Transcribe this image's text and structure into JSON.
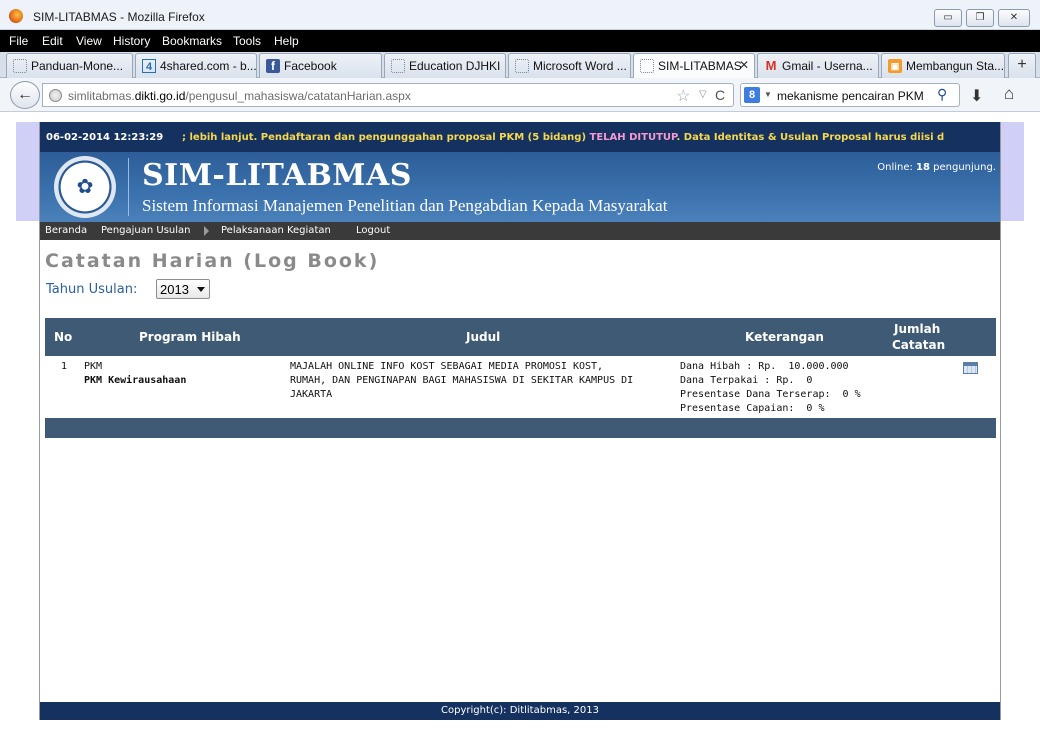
{
  "window": {
    "title": "SIM-LITABMAS - Mozilla Firefox",
    "min_icon": "minimize-icon",
    "max_icon": "maximize-icon",
    "close_icon": "close-icon"
  },
  "menu": [
    "File",
    "Edit",
    "View",
    "History",
    "Bookmarks",
    "Tools",
    "Help"
  ],
  "tabs": [
    {
      "label": "Panduan-Mone...",
      "icon": "blank-page-icon"
    },
    {
      "label": "4shared.com - b...",
      "icon": "4shared-icon"
    },
    {
      "label": "Facebook",
      "icon": "facebook-icon"
    },
    {
      "label": "Education DJHKI",
      "icon": "blank-page-icon"
    },
    {
      "label": "Microsoft Word ...",
      "icon": "blank-page-icon"
    },
    {
      "label": "SIM-LITABMAS",
      "icon": "blank-page-icon",
      "active": true
    },
    {
      "label": "Gmail - Userna...",
      "icon": "gmail-icon"
    },
    {
      "label": "Membangun Sta...",
      "icon": "orange-site-icon"
    }
  ],
  "address": {
    "url_prefix": "simlitabmas.",
    "url_domain": "dikti.go.id",
    "url_path": "/pengusul_mahasiswa/catatanHarian.aspx"
  },
  "search": {
    "engine_icon": "google-icon",
    "value": "mekanisme pencairan PKM"
  },
  "site": {
    "date": "06-02-2014",
    "time": "12:23:29",
    "marquee_a": "; lebih lanjut.   Pendaftaran dan pengunggahan proposal PKM (5 bidang) ",
    "marquee_b": "TELAH DITUTUP",
    "marquee_c": ".   Data Identitas & Usulan Proposal harus diisi d",
    "name": "SIM-LITABMAS",
    "subtitle": "Sistem Informasi Manajemen Penelitian dan Pengabdian Kepada Masyarakat",
    "online_prefix": "Online: ",
    "online_count": "18",
    "online_suffix": " pengunjung.",
    "nav": [
      "Beranda",
      "Pengajuan Usulan",
      "Pelaksanaan Kegiatan",
      "Logout"
    ]
  },
  "page": {
    "title": "Catatan Harian (Log Book)",
    "year_label": "Tahun Usulan:",
    "year_value": "2013"
  },
  "table": {
    "headers": [
      "No",
      "Program Hibah",
      "Judul",
      "Keterangan",
      "Jumlah",
      "Catatan"
    ],
    "rows": [
      {
        "no": "1",
        "program": "PKM",
        "subprogram": "PKM Kewirausahaan",
        "judul_lines": [
          "MAJALAH ONLINE INFO KOST SEBAGAI MEDIA PROMOSI KOST,",
          "RUMAH, DAN PENGINAPAN BAGI MAHASISWA DI SEKITAR KAMPUS DI",
          "JAKARTA"
        ],
        "keterangan_lines": [
          "Dana Hibah : Rp.  10.000.000",
          "Dana Terpakai : Rp.  0",
          "Presentase Dana Terserap:  0 %",
          "Presentase Capaian:  0 %"
        ],
        "action_icon": "calendar-icon"
      }
    ]
  },
  "footer": "Copyright(c): Ditlitabmas, 2013"
}
